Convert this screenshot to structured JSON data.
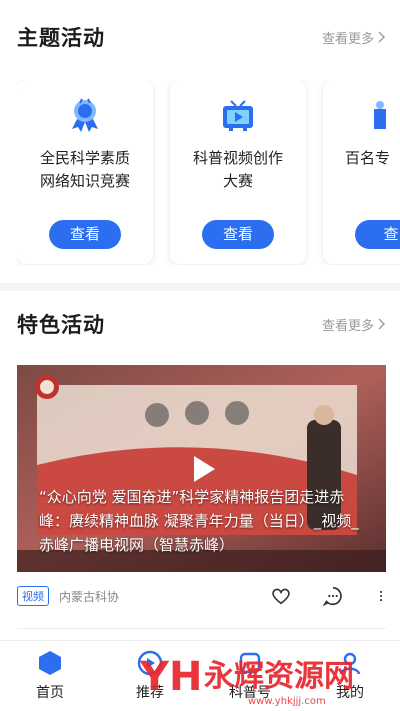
{
  "theme_section": {
    "title": "主题活动",
    "more": "查看更多",
    "cards": [
      {
        "icon": "award-ribbon-icon",
        "line1": "全民科学素质",
        "line2": "网络知识竞赛",
        "button": "查看"
      },
      {
        "icon": "tv-play-icon",
        "line1": "科普视频创作",
        "line2": "大赛",
        "button": "查看"
      },
      {
        "icon": "partial-icon",
        "line1": "百名专",
        "line2": "",
        "button": "查"
      }
    ]
  },
  "feature_section": {
    "title": "特色活动",
    "more": "查看更多",
    "video": {
      "title": "“众心向党 爱国奋进”科学家精神报告团走进赤峰：赓续精神血脉 凝聚青年力量（当日）_视频_赤峰广播电视网（智慧赤峰）",
      "tag": "视频",
      "org": "内蒙古科协"
    }
  },
  "tabbar": {
    "items": [
      {
        "label": "首页",
        "icon": "home-hexagon-icon"
      },
      {
        "label": "推荐",
        "icon": "play-circle-icon"
      },
      {
        "label": "科普号",
        "icon": "portal-icon"
      },
      {
        "label": "我的",
        "icon": "profile-icon"
      }
    ]
  },
  "watermark": {
    "text": "永辉资源网",
    "url": "www.yhkjjj.com"
  },
  "colors": {
    "accent": "#2b6ff0",
    "text": "#222222",
    "muted": "#9a9a9a",
    "watermark": "#e8262c"
  }
}
